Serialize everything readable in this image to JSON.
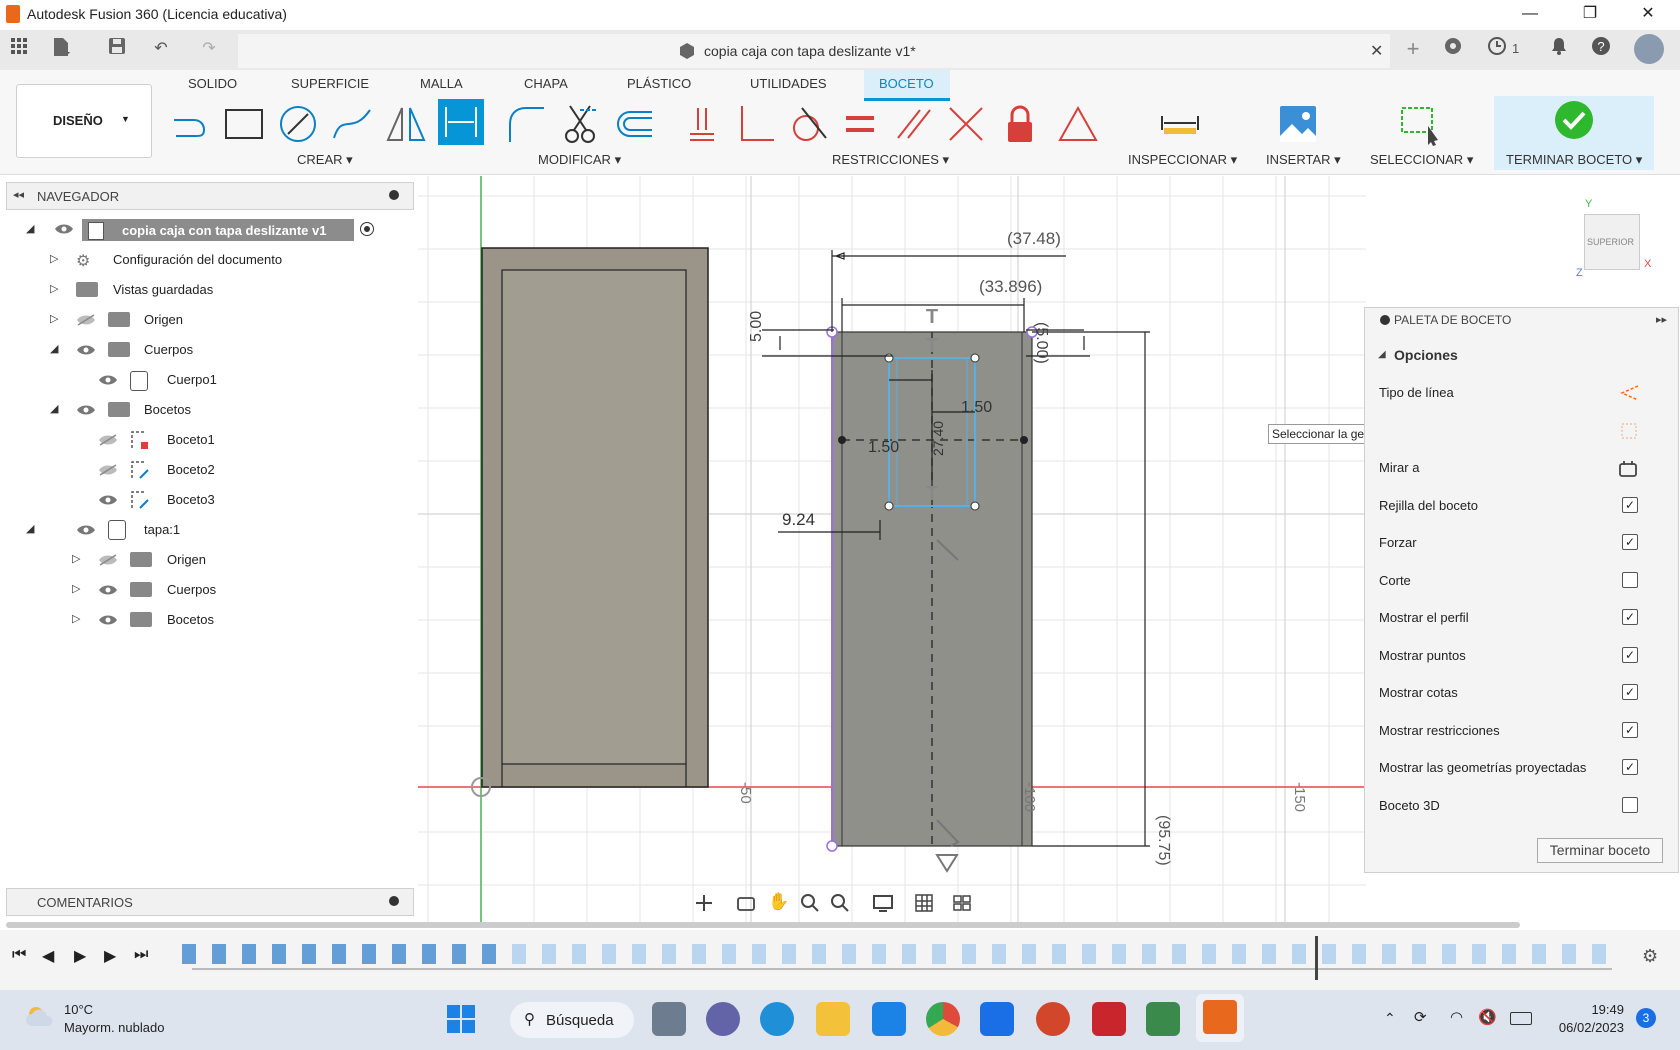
{
  "window": {
    "title": "Autodesk Fusion 360 (Licencia educativa)",
    "minimize": "—",
    "restore": "❐",
    "close": "✕"
  },
  "document_tab": {
    "title": "copia caja con tapa deslizante v1*",
    "close": "✕",
    "jobs_count": "1"
  },
  "ribbon": {
    "workspace": "DISEÑO",
    "tabs": [
      "SOLIDO",
      "SUPERFICIE",
      "MALLA",
      "CHAPA",
      "PLÁSTICO",
      "UTILIDADES",
      "BOCETO"
    ],
    "active_tab": "BOCETO",
    "groups": {
      "crear": "CREAR",
      "modificar": "MODIFICAR",
      "restricciones": "RESTRICCIONES",
      "inspeccionar": "INSPECCIONAR",
      "insertar": "INSERTAR",
      "seleccionar": "SELECCIONAR",
      "terminar": "TERMINAR BOCETO"
    }
  },
  "browser": {
    "header": "NAVEGADOR",
    "root": "copia caja con tapa deslizante v1",
    "items": [
      {
        "label": "Configuración del documento"
      },
      {
        "label": "Vistas guardadas"
      },
      {
        "label": "Origen"
      },
      {
        "label": "Cuerpos"
      },
      {
        "label": "Cuerpo1"
      },
      {
        "label": "Bocetos"
      },
      {
        "label": "Boceto1"
      },
      {
        "label": "Boceto2"
      },
      {
        "label": "Boceto3"
      },
      {
        "label": "tapa:1"
      },
      {
        "label": "Origen"
      },
      {
        "label": "Cuerpos"
      },
      {
        "label": "Bocetos"
      }
    ],
    "comments": "COMENTARIOS"
  },
  "canvas": {
    "dims": {
      "d1": "(37.48)",
      "d2": "(33.896)",
      "d3": "5.00",
      "d4": "(5.00)",
      "d5": "1.50",
      "d6": "1.50",
      "d7": "27.40",
      "d8": "9.24",
      "d9": "(95.75)"
    },
    "axis": {
      "a1": "-50",
      "a2": "-100",
      "a3": "-150"
    },
    "tooltip": "Seleccionar la geometría del boceto para acotar",
    "viewcube": "SUPERIOR",
    "axis_x": "X",
    "axis_y": "Y",
    "axis_z": "Z"
  },
  "palette": {
    "title": "PALETA DE BOCETO",
    "section": "Opciones",
    "rows": [
      {
        "label": "Tipo de línea",
        "type": "icon"
      },
      {
        "label": "Mirar a",
        "type": "icon"
      },
      {
        "label": "Rejilla del boceto",
        "type": "check",
        "checked": true
      },
      {
        "label": "Forzar",
        "type": "check",
        "checked": true
      },
      {
        "label": "Corte",
        "type": "check",
        "checked": false
      },
      {
        "label": "Mostrar el perfil",
        "type": "check",
        "checked": true
      },
      {
        "label": "Mostrar puntos",
        "type": "check",
        "checked": true
      },
      {
        "label": "Mostrar cotas",
        "type": "check",
        "checked": true
      },
      {
        "label": "Mostrar restricciones",
        "type": "check",
        "checked": true
      },
      {
        "label": "Mostrar las geometrías proyectadas",
        "type": "check",
        "checked": true
      },
      {
        "label": "Boceto 3D",
        "type": "check",
        "checked": false
      }
    ],
    "finish_button": "Terminar boceto"
  },
  "taskbar": {
    "weather_temp": "10°C",
    "weather_desc": "Mayorm. nublado",
    "search": "Búsqueda",
    "time": "19:49",
    "date": "06/02/2023",
    "notifications": "3"
  },
  "colors": {
    "accent": "#0696d7",
    "body_fill": "#9a9588",
    "sketch_fill": "#8f9089",
    "finish_green": "#2eb82e",
    "constraint_red": "#d6403a"
  }
}
